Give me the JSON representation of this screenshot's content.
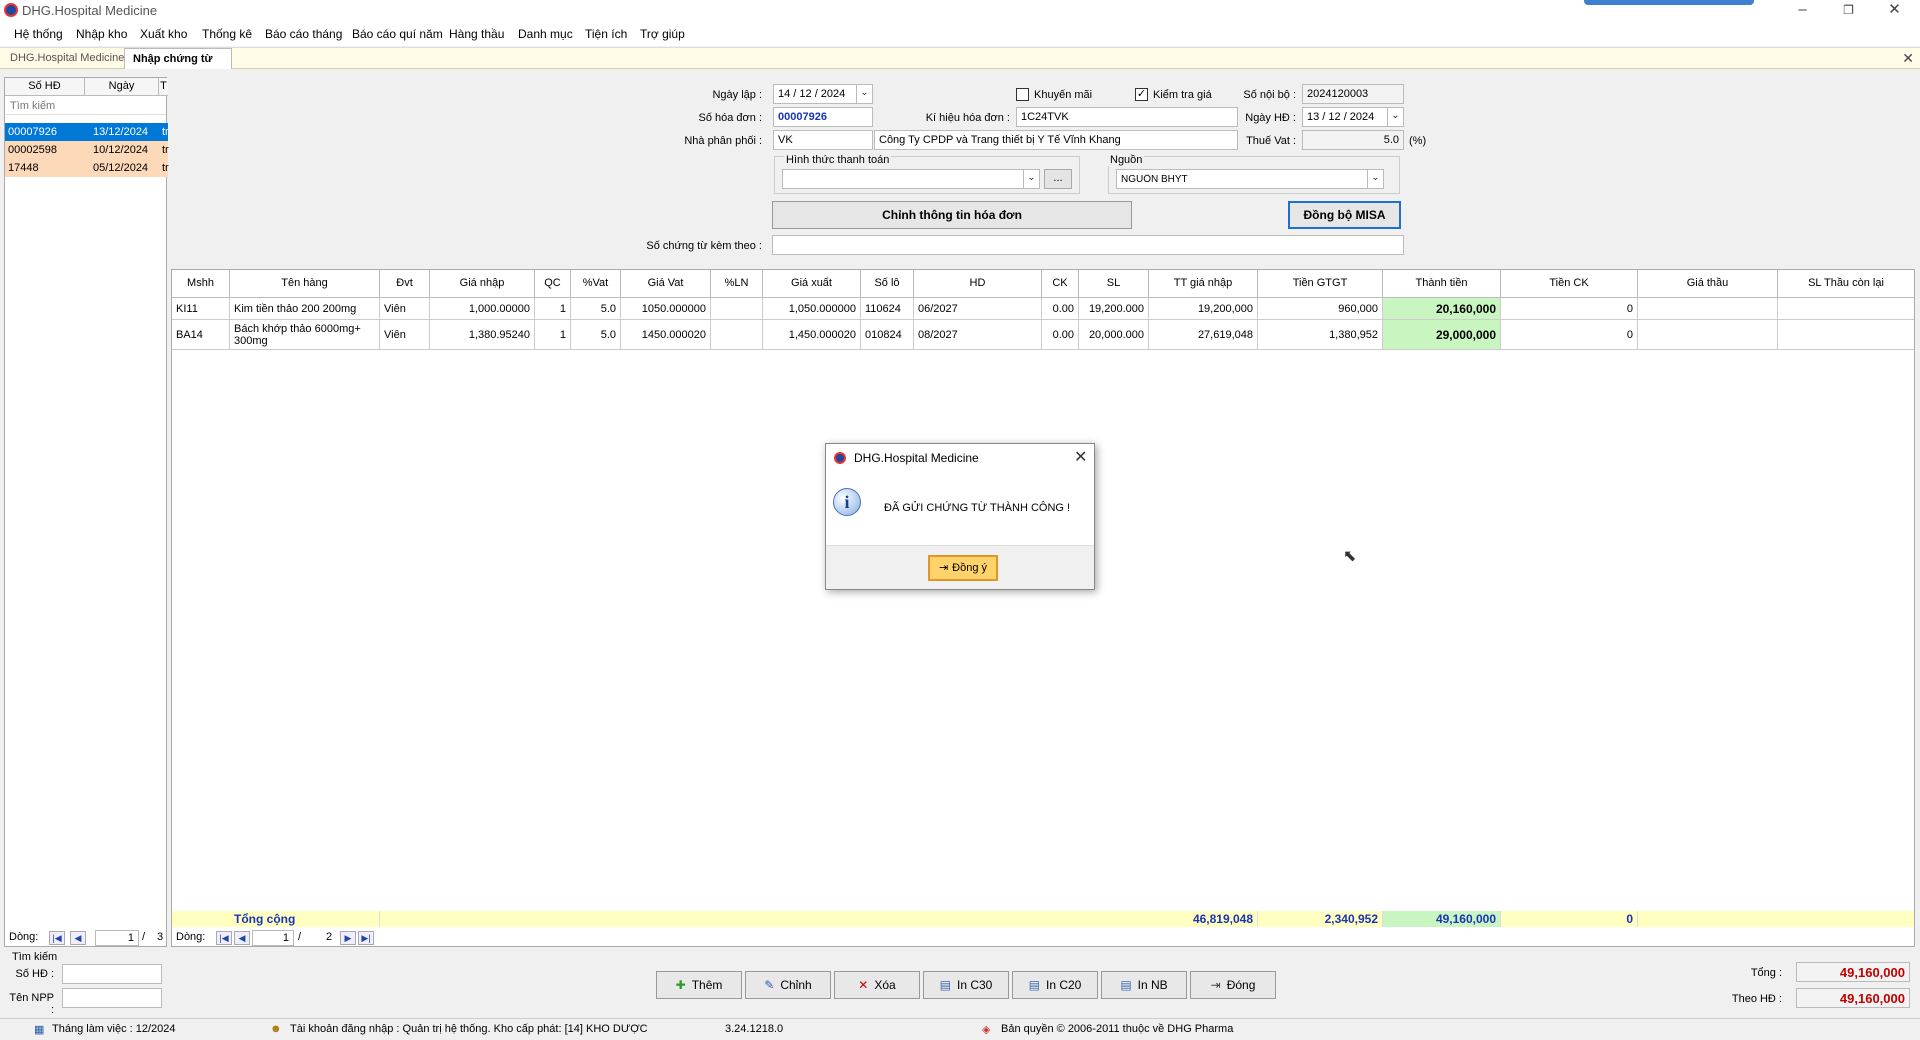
{
  "title": "DHG.Hospital Medicine",
  "menu": [
    "Hệ thống",
    "Nhập kho",
    "Xuất kho",
    "Thống kê",
    "Báo cáo tháng",
    "Báo cáo quí năm",
    "Hàng thầu",
    "Danh mục",
    "Tiện ích",
    "Trợ giúp"
  ],
  "tabs": {
    "home": "DHG.Hospital Medicine",
    "active": "Nhập chứng từ"
  },
  "left": {
    "col_so": "Số HĐ",
    "col_ngay": "Ngày",
    "col_t": "T",
    "search_placeholder": "Tìm kiếm",
    "rows": [
      {
        "so": "00007926",
        "ngay": "13/12/2024",
        "t": "tr"
      },
      {
        "so": "00002598",
        "ngay": "10/12/2024",
        "t": "tr"
      },
      {
        "so": "17448",
        "ngay": "05/12/2024",
        "t": "tr"
      }
    ],
    "dong_label": "Dòng:",
    "page": "1",
    "total": "3"
  },
  "form": {
    "ngay_lap_label": "Ngày lập :",
    "ngay_lap": "14 / 12 / 2024",
    "khuyen_mai": "Khuyến mãi",
    "kiem_tra_gia": "Kiểm tra giá",
    "so_noi_bo_label": "Số nội bộ :",
    "so_noi_bo": "2024120003",
    "so_hoa_don_label": "Số hóa đơn :",
    "so_hoa_don": "00007926",
    "ki_hieu_label": "Kí hiệu hóa đơn :",
    "ki_hieu": "1C24TVK",
    "ngay_hd_label": "Ngày HĐ :",
    "ngay_hd": "13 / 12 / 2024",
    "npp_label": "Nhà phân phối :",
    "npp_code": "VK",
    "npp_name": "Công Ty CPDP và Trang thiết bị Y Tế Vĩnh Khang",
    "thue_label": "Thuế Vat :",
    "thue": "5.0",
    "pct": "(%)",
    "httt_label": "Hình thức thanh toán",
    "httt": "",
    "ellipsis": "...",
    "nguon_label": "Nguồn",
    "nguon": "NGUỒN BHYT",
    "btn_chinh": "Chỉnh thông tin hóa đơn",
    "btn_misa": "Đồng bộ MISA",
    "so_ct_label": "Số chứng từ kèm theo :",
    "so_ct": ""
  },
  "grid": {
    "headers": [
      "Mshh",
      "Tên hàng",
      "Đvt",
      "Giá nhập",
      "QC",
      "%Vat",
      "Giá Vat",
      "%LN",
      "Giá xuất",
      "Số lô",
      "HD",
      "CK",
      "SL",
      "TT giá nhập",
      "Tiền GTGT",
      "Thành tiền",
      "Tiền CK",
      "Giá thầu",
      "SL Thầu còn lại"
    ],
    "rows": [
      [
        "KI11",
        "Kim tiền thảo 200 200mg",
        "Viên",
        "1,000.00000",
        "1",
        "5.0",
        "1050.000000",
        "",
        "1,050.000000",
        "110624",
        "06/2027",
        "0.00",
        "19,200.000",
        "19,200,000",
        "960,000",
        "20,160,000",
        "0",
        "",
        ""
      ],
      [
        "BA14",
        "Bách khớp thảo 6000mg+ 300mg",
        "Viên",
        "1,380.95240",
        "1",
        "5.0",
        "1450.000020",
        "",
        "1,450.000020",
        "010824",
        "08/2027",
        "0.00",
        "20,000.000",
        "27,619,048",
        "1,380,952",
        "29,000,000",
        "0",
        "",
        ""
      ]
    ],
    "total_label": "Tổng cộng",
    "total_tt": "46,819,048",
    "total_gtgt": "2,340,952",
    "total_thanh": "49,160,000",
    "total_ck": "0",
    "dong_label": "Dòng:",
    "page": "1",
    "total_pages": "2"
  },
  "search": {
    "title": "Tìm kiếm",
    "so_hd": "Số HĐ :",
    "ten_npp": "Tên NPP :"
  },
  "buttons": [
    "Thêm",
    "Chỉnh",
    "Xóa",
    "In C30",
    "In C20",
    "In NB",
    "Đóng"
  ],
  "summary": {
    "tong_label": "Tổng :",
    "tong": "49,160,000",
    "theo_label": "Theo HĐ :",
    "theo": "49,160,000"
  },
  "status": {
    "thang": "Tháng làm việc : 12/2024",
    "tk": "Tài khoản đăng nhập : Quản trị hệ thống. Kho cấp phát: [14] KHO DƯỢC",
    "version": "3.24.1218.0",
    "copyright": "Bản quyền © 2006-2011 thuộc về DHG Pharma"
  },
  "dialog": {
    "title": "DHG.Hospital Medicine",
    "message": "ĐÃ GỬI CHỨNG TỪ THÀNH CÔNG !",
    "ok": "Đồng ý"
  },
  "colors": {
    "accent": "#1a34b8",
    "selected_row": "#0078d7",
    "highlight_green": "#c8f5c0",
    "total_bg": "#ffffc0",
    "red": "#c00000"
  }
}
